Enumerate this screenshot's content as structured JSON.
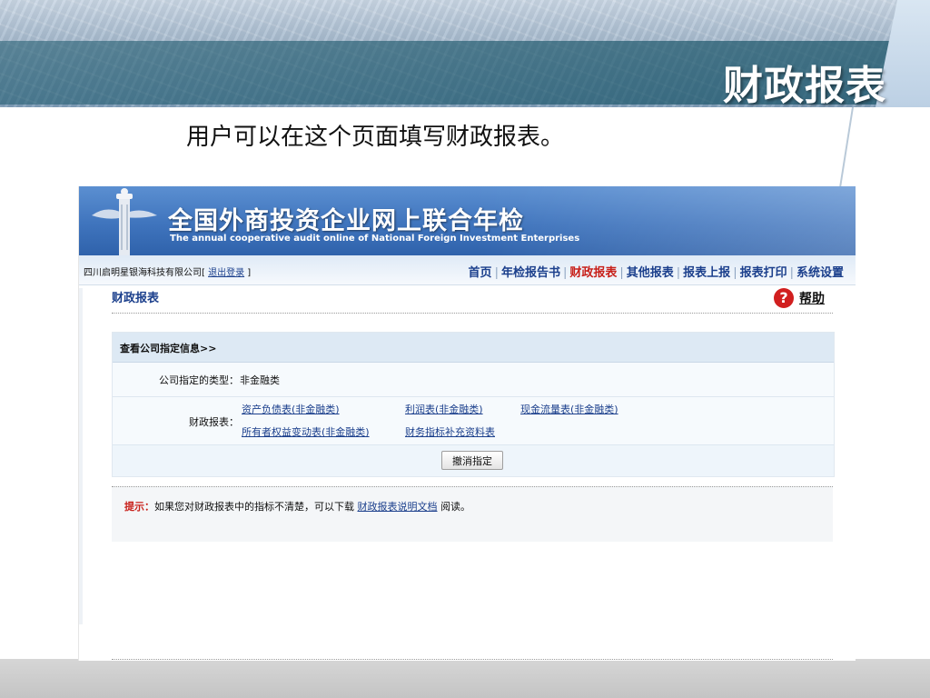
{
  "slide": {
    "title": "财政报表",
    "subtitle": "用户可以在这个页面填写财政报表。"
  },
  "site": {
    "title": "全国外商投资企业网上联合年检",
    "subtitle": "The annual cooperative audit online  of National Foreign Investment Enterprises",
    "company": "四川启明星银海科技有限公司",
    "logout_prefix": "[",
    "logout_label": "退出登录",
    "logout_suffix": "]"
  },
  "nav": {
    "items": [
      "首页",
      "年检报告书",
      "财政报表",
      "其他报表",
      "报表上报",
      "报表打印",
      "系统设置"
    ],
    "active": "财政报表",
    "separator": "|"
  },
  "section": {
    "title": "财政报表",
    "help_label": "帮助",
    "help_icon_char": "?"
  },
  "panel": {
    "header": "查看公司指定信息>>",
    "type_label": "公司指定的类型：",
    "type_value": "非金融类",
    "reports_label": "财政报表：",
    "links": [
      "资产负债表(非金融类)",
      "利润表(非金融类)",
      "现金流量表(非金融类)",
      "所有者权益变动表(非金融类)",
      "财务指标补充资料表"
    ],
    "cancel_button": "撤消指定"
  },
  "tip": {
    "label": "提示：",
    "text_before": "如果您对财政报表中的指标不清楚，可以下载",
    "link": "财政报表说明文档",
    "text_after": "阅读。"
  },
  "colors": {
    "link_blue": "#1b3f8c",
    "active_red": "#c8201a",
    "banner_blue": "#3f74bd"
  }
}
